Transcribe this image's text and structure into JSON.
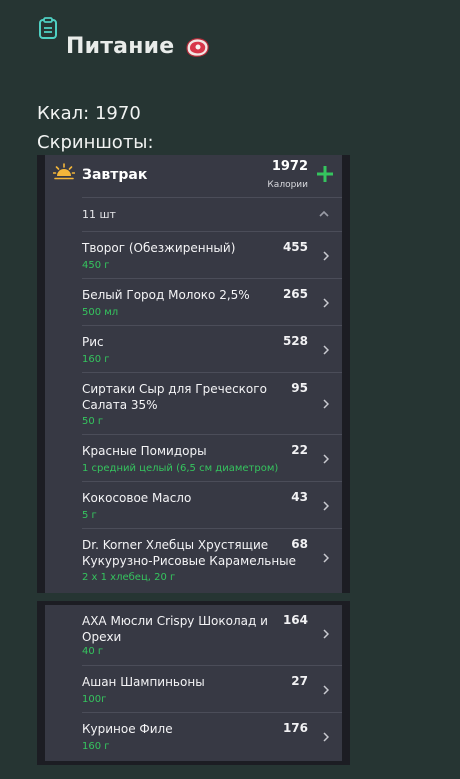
{
  "page": {
    "title": "Питание",
    "kcal_line": "Ккал: 1970",
    "screenshots_label": "Скриншоты:"
  },
  "colors": {
    "background": "#263533",
    "panel": "#373944",
    "accent_green": "#35c45e",
    "icon_teal": "#4fd0c3"
  },
  "icons": [
    "clipboard-icon",
    "meat-icon",
    "sun-icon",
    "add-icon",
    "chevron-up-icon",
    "chevron-right-icon"
  ],
  "meal": {
    "name": "Завтрак",
    "calories": "1972",
    "calories_label": "Калории",
    "count": "11 шт"
  },
  "screenshot1_items": [
    {
      "name": "Творог (Обезжиренный)",
      "amount": "450 г",
      "kcal": "455"
    },
    {
      "name": "Белый Город Молоко 2,5%",
      "amount": "500 мл",
      "kcal": "265"
    },
    {
      "name": "Рис",
      "amount": "160 г",
      "kcal": "528"
    },
    {
      "name": "Сиртаки Сыр для Греческого Салата 35%",
      "amount": "50 г",
      "kcal": "95"
    },
    {
      "name": "Красные Помидоры",
      "amount": "1 средний целый (6,5 см диаметром)",
      "kcal": "22"
    },
    {
      "name": "Кокосовое Масло",
      "amount": "5 г",
      "kcal": "43"
    },
    {
      "name": "Dr. Korner Хлебцы Хрустящие Кукурузно-Рисовые Карамельные",
      "amount": "2 x 1 хлебец, 20 г",
      "kcal": "68"
    }
  ],
  "screenshot2_items": [
    {
      "name": "AXA Мюсли Crispy Шоколад и Орехи",
      "amount": "40 г",
      "kcal": "164"
    },
    {
      "name": "Ашан Шампиньоны",
      "amount": "100г",
      "kcal": "27"
    },
    {
      "name": "Куриное Филе",
      "amount": "160 г",
      "kcal": "176"
    }
  ]
}
